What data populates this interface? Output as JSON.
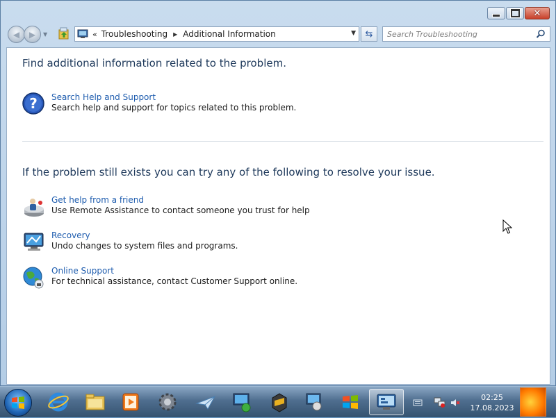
{
  "window": {
    "caption_buttons": [
      "minimize",
      "maximize",
      "close"
    ]
  },
  "nav": {
    "back_icon": "back-arrow-icon",
    "forward_icon": "forward-arrow-icon",
    "address": {
      "overflow": "«",
      "crumbs": [
        "Troubleshooting",
        "Additional Information"
      ]
    },
    "search_placeholder": "Search Troubleshooting"
  },
  "content": {
    "heading1": "Find additional information related to the problem.",
    "help": {
      "link": "Search Help and Support",
      "desc": "Search help and support for topics related to this problem."
    },
    "heading2": "If the problem still exists you can try any of the following to resolve your issue.",
    "tasks": [
      {
        "link": "Get help from a friend",
        "desc": "Use Remote Assistance to contact someone you trust for help"
      },
      {
        "link": "Recovery",
        "desc": "Undo changes to system files and programs."
      },
      {
        "link": "Online Support",
        "desc": "For technical assistance, contact Customer Support online."
      }
    ]
  },
  "taskbar": {
    "items": [
      "internet-explorer-icon",
      "explorer-folder-icon",
      "media-player-icon",
      "settings-gear-icon",
      "paper-plane-icon",
      "network-computer-icon",
      "program-icon",
      "remote-computer-icon",
      "windows-logo-icon",
      "control-panel-icon"
    ],
    "clock_time": "02:25",
    "clock_date": "17.08.2023"
  },
  "colors": {
    "link": "#1e5cae",
    "heading": "#1e395b",
    "close_button": "#c8402a"
  }
}
